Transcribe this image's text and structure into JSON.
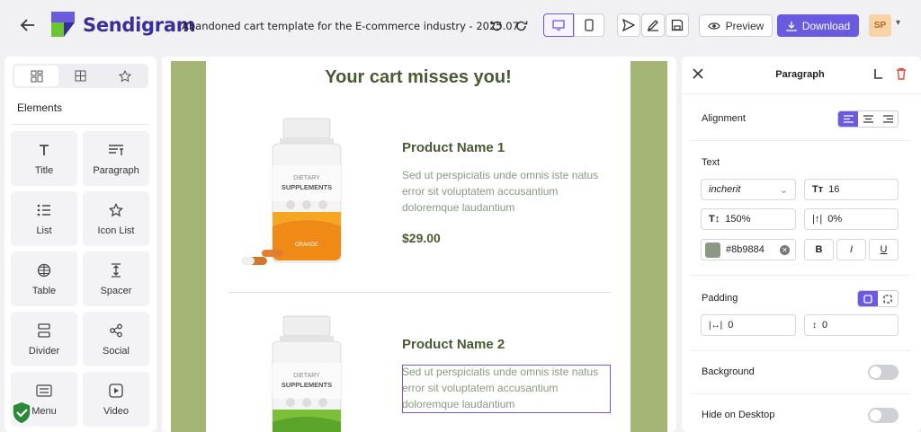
{
  "app": {
    "brand": "Sendigram",
    "doc_title": "Abandoned cart template for the E-commerce industry  - 2025.07"
  },
  "toolbar": {
    "preview_label": "Preview",
    "download_label": "Download",
    "avatar_initials": "SP",
    "accent_color": "#6a5ae0"
  },
  "left_panel": {
    "section_label": "Elements",
    "tabs": [
      "layout-icon",
      "grid-icon",
      "star-icon"
    ],
    "elements": [
      {
        "label": "Title",
        "icon": "title-icon"
      },
      {
        "label": "Paragraph",
        "icon": "paragraph-icon"
      },
      {
        "label": "List",
        "icon": "list-icon"
      },
      {
        "label": "Icon List",
        "icon": "star-icon"
      },
      {
        "label": "Table",
        "icon": "table-icon"
      },
      {
        "label": "Spacer",
        "icon": "spacer-icon"
      },
      {
        "label": "Divider",
        "icon": "divider-icon"
      },
      {
        "label": "Social",
        "icon": "share-icon"
      },
      {
        "label": "Menu",
        "icon": "menu-icon"
      },
      {
        "label": "Video",
        "icon": "video-icon"
      }
    ]
  },
  "email": {
    "title": "Your cart misses you!",
    "products": [
      {
        "name": "Product Name 1",
        "description": "Sed ut perspiciatis unde omnis iste natus error sit voluptatem accusantium doloremque laudantium",
        "price": "$29.00",
        "label_color": "#f5a623"
      },
      {
        "name": "Product Name 2",
        "description": "Sed ut perspiciatis unde omnis iste natus error sit voluptatem accusantium doloremque laudantium",
        "price": "",
        "label_color": "#7cbf3a"
      }
    ],
    "bottle_text": {
      "line1": "DIETARY",
      "line2": "SUPPLEMENTS",
      "flavor": "ORANGE"
    },
    "background_color": "#a5b576",
    "text_color": "#8b9884"
  },
  "right_panel": {
    "title": "Paragraph",
    "alignment_label": "Alignment",
    "text_label": "Text",
    "font_family": "incherit",
    "font_size": "16",
    "line_height": "150%",
    "letter_spacing": "0%",
    "color_value": "#8b9884",
    "bold_label": "B",
    "italic_label": "I",
    "underline_label": "U",
    "padding_label": "Padding",
    "padding_x": "0",
    "padding_y": "0",
    "background_label": "Background",
    "hide_desktop_label": "Hide on Desktop"
  }
}
